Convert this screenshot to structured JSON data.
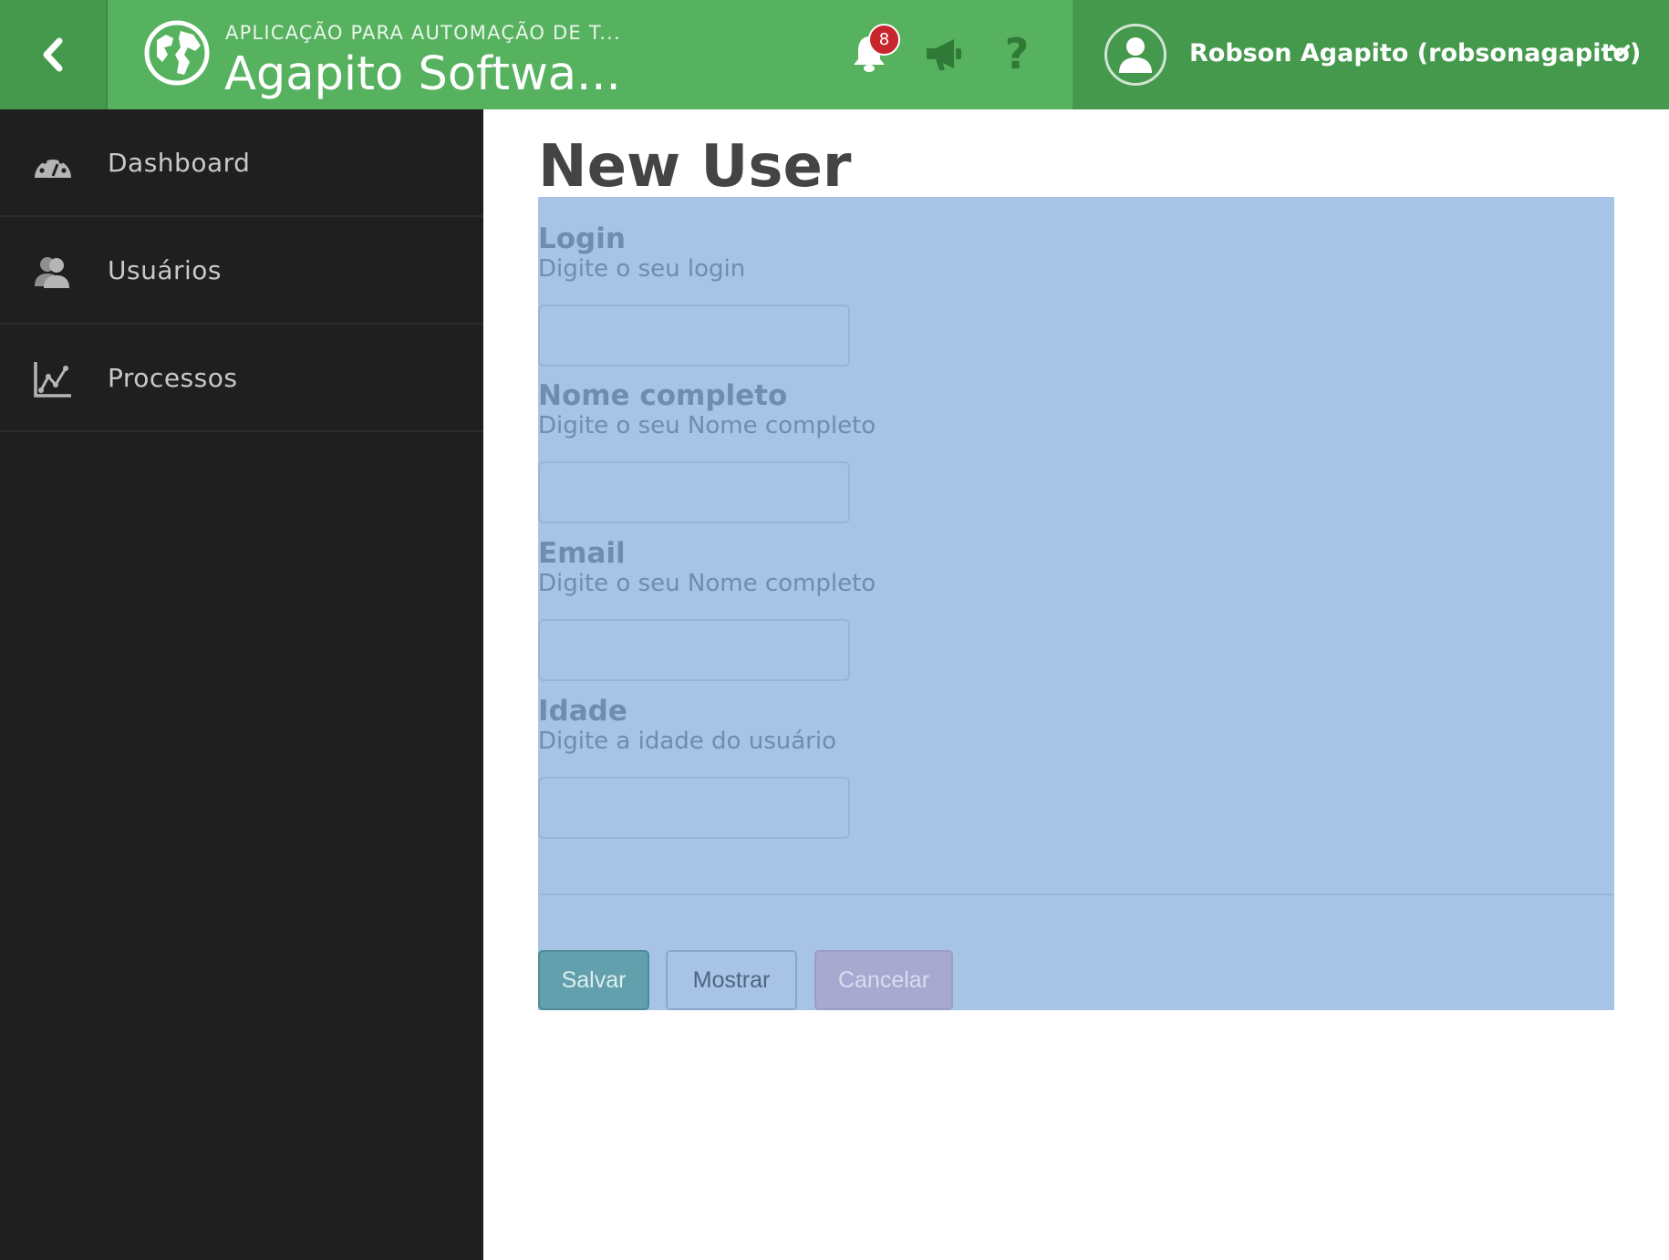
{
  "header": {
    "app_subtitle": "APLICAÇÃO PARA AUTOMAÇÃO DE T...",
    "app_title": "Agapito Softwa...",
    "notifications_count": "8",
    "help_glyph": "?",
    "user_name": "Robson Agapito (robsonagapito)"
  },
  "sidebar": {
    "items": [
      {
        "label": "Dashboard",
        "icon": "dashboard-gauge-icon"
      },
      {
        "label": "Usuários",
        "icon": "users-icon"
      },
      {
        "label": "Processos",
        "icon": "line-chart-icon"
      }
    ]
  },
  "page": {
    "title": "New User"
  },
  "form": {
    "fields": [
      {
        "label": "Login",
        "help": "Digite o seu login",
        "value": ""
      },
      {
        "label": "Nome completo",
        "help": "Digite o seu Nome completo",
        "value": ""
      },
      {
        "label": "Email",
        "help": "Digite o seu Nome completo",
        "value": ""
      },
      {
        "label": "Idade",
        "help": "Digite a idade do usuário",
        "value": ""
      }
    ],
    "buttons": {
      "save": "Salvar",
      "show": "Mostrar",
      "cancel": "Cancelar"
    }
  },
  "colors": {
    "header_green": "#56b25f",
    "header_dark_green": "#45994d",
    "sidebar_bg": "#1f1f1f",
    "form_highlight": "#a7c3e5",
    "badge_red": "#c7262c"
  }
}
